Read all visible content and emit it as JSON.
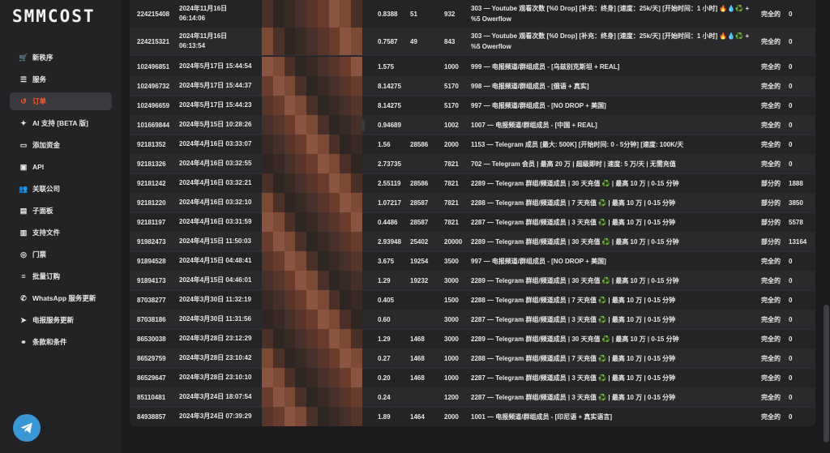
{
  "app": {
    "logo_text": "SMMCOST"
  },
  "sidebar": {
    "items": [
      {
        "label": "新秩序",
        "icon": "cart-icon",
        "glyph": "🛒",
        "active": false
      },
      {
        "label": "服务",
        "icon": "list-icon",
        "glyph": "☰",
        "active": false
      },
      {
        "label": "订单",
        "icon": "history-icon",
        "glyph": "↺",
        "active": true
      },
      {
        "label": "AI 支持 [BETA 版]",
        "icon": "brain-icon",
        "glyph": "✦",
        "active": false
      },
      {
        "label": "添加资金",
        "icon": "wallet-icon",
        "glyph": "▭",
        "active": false
      },
      {
        "label": "API",
        "icon": "api-icon",
        "glyph": "▣",
        "active": false
      },
      {
        "label": "关联公司",
        "icon": "users-icon",
        "glyph": "👥",
        "active": false
      },
      {
        "label": "子面板",
        "icon": "panel-icon",
        "glyph": "▤",
        "active": false
      },
      {
        "label": "支持文件",
        "icon": "library-icon",
        "glyph": "▥",
        "active": false
      },
      {
        "label": "门票",
        "icon": "ticket-icon",
        "glyph": "◎",
        "active": false
      },
      {
        "label": "批量订购",
        "icon": "layers-icon",
        "glyph": "≡",
        "active": false
      },
      {
        "label": "WhatsApp 服务更新",
        "icon": "whatsapp-icon",
        "glyph": "✆",
        "active": false
      },
      {
        "label": "电报服务更新",
        "icon": "telegram-icon",
        "glyph": "➤",
        "active": false
      },
      {
        "label": "条款和条件",
        "icon": "handshake-icon",
        "glyph": "⚭",
        "active": false
      }
    ]
  },
  "colors": {
    "accent": "#ff5a2e",
    "telegram": "#3a97d5"
  },
  "orders": [
    {
      "id": "224215408",
      "date": "2024年11月16日\n06:14:06",
      "charge": "0.8388",
      "start": "51",
      "qty": "932",
      "service": "303 — Youtube 观看次数 [%0 Drop] [补充：终身] [速度：25k/天] [开始时间：1 小时] 🔥💧♻️ + %5 Owerflow",
      "status": "完全的",
      "remains": "0"
    },
    {
      "id": "224215321",
      "date": "2024年11月16日\n06:13:54",
      "charge": "0.7587",
      "start": "49",
      "qty": "843",
      "service": "303 — Youtube 观看次数 [%0 Drop] [补充：终身] [速度：25k/天] [开始时间：1 小时] 🔥💧♻️ + %5 Owerflow",
      "status": "完全的",
      "remains": "0"
    },
    {
      "id": "102496851",
      "date": "2024年5月17日 15:44:54",
      "charge": "1.575",
      "start": "",
      "qty": "1000",
      "service": "999 — 电报频道/群组成员 - [乌兹别克斯坦 + REAL]",
      "status": "完全的",
      "remains": "0"
    },
    {
      "id": "102496732",
      "date": "2024年5月17日 15:44:37",
      "charge": "8.14275",
      "start": "",
      "qty": "5170",
      "service": "998 — 电报频道/群组成员 - [俄语 + 真实]",
      "status": "完全的",
      "remains": "0"
    },
    {
      "id": "102496659",
      "date": "2024年5月17日 15:44:23",
      "charge": "8.14275",
      "start": "",
      "qty": "5170",
      "service": "997 — 电报频道/群组成员 - [NO DROP + 美国]",
      "status": "完全的",
      "remains": "0"
    },
    {
      "id": "101669844",
      "date": "2024年5月15日 10:28:26",
      "charge": "0.94689",
      "start": "",
      "qty": "1002",
      "service": "1007 — 电报频道/群组成员 - [中国 + REAL]",
      "status": "完全的",
      "remains": "0"
    },
    {
      "id": "92181352",
      "date": "2024年4月16日 03:33:07",
      "charge": "1.56",
      "start": "28586",
      "qty": "2000",
      "service": "1153 — Telegram 成员 [最大: 500K] [开始时间: 0 - 5分钟] [速度: 100K/天",
      "status": "完全的",
      "remains": "0"
    },
    {
      "id": "92181326",
      "date": "2024年4月16日 03:32:55",
      "charge": "2.73735",
      "start": "",
      "qty": "7821",
      "service": "702 — Telegram 会员 | 最高 20 万 | 超级即时 | 速度: 5 万/天 | 无需充值",
      "status": "完全的",
      "remains": "0"
    },
    {
      "id": "92181242",
      "date": "2024年4月16日 03:32:21",
      "charge": "2.55119",
      "start": "28586",
      "qty": "7821",
      "service": "2289 — Telegram 群组/频道成员 | 30 天充值 ♻️ | 最高 10 万 | 0-15 分钟",
      "status": "部分的",
      "remains": "1888"
    },
    {
      "id": "92181220",
      "date": "2024年4月16日 03:32:10",
      "charge": "1.07217",
      "start": "28587",
      "qty": "7821",
      "service": "2288 — Telegram 群组/频道成员 | 7 天充值 ♻️ | 最高 10 万 | 0-15 分钟",
      "status": "部分的",
      "remains": "3850"
    },
    {
      "id": "92181197",
      "date": "2024年4月16日 03:31:59",
      "charge": "0.4486",
      "start": "28587",
      "qty": "7821",
      "service": "2287 — Telegram 群组/频道成员 | 3 天充值 ♻️ | 最高 10 万 | 0-15 分钟",
      "status": "部分的",
      "remains": "5578"
    },
    {
      "id": "91982473",
      "date": "2024年4月15日 11:50:03",
      "charge": "2.93948",
      "start": "25402",
      "qty": "20000",
      "service": "2289 — Telegram 群组/频道成员 | 30 天充值 ♻️ | 最高 10 万 | 0-15 分钟",
      "status": "部分的",
      "remains": "13164"
    },
    {
      "id": "91894528",
      "date": "2024年4月15日 04:48:41",
      "charge": "3.675",
      "start": "19254",
      "qty": "3500",
      "service": "997 — 电报频道/群组成员 - [NO DROP + 美国]",
      "status": "完全的",
      "remains": "0"
    },
    {
      "id": "91894173",
      "date": "2024年4月15日 04:46:01",
      "charge": "1.29",
      "start": "19232",
      "qty": "3000",
      "service": "2289 — Telegram 群组/频道成员 | 30 天充值 ♻️ | 最高 10 万 | 0-15 分钟",
      "status": "完全的",
      "remains": "0"
    },
    {
      "id": "87038277",
      "date": "2024年3月30日 11:32:19",
      "charge": "0.405",
      "start": "",
      "qty": "1500",
      "service": "2288 — Telegram 群组/频道成员 | 7 天充值 ♻️ | 最高 10 万 | 0-15 分钟",
      "status": "完全的",
      "remains": "0"
    },
    {
      "id": "87038186",
      "date": "2024年3月30日 11:31:56",
      "charge": "0.60",
      "start": "",
      "qty": "3000",
      "service": "2287 — Telegram 群组/频道成员 | 3 天充值 ♻️ | 最高 10 万 | 0-15 分钟",
      "status": "完全的",
      "remains": "0"
    },
    {
      "id": "86530038",
      "date": "2024年3月28日 23:12:29",
      "charge": "1.29",
      "start": "1468",
      "qty": "3000",
      "service": "2289 — Telegram 群组/频道成员 | 30 天充值 ♻️ | 最高 10 万 | 0-15 分钟",
      "status": "完全的",
      "remains": "0"
    },
    {
      "id": "86529759",
      "date": "2024年3月28日 23:10:42",
      "charge": "0.27",
      "start": "1468",
      "qty": "1000",
      "service": "2288 — Telegram 群组/频道成员 | 7 天充值 ♻️ | 最高 10 万 | 0-15 分钟",
      "status": "完全的",
      "remains": "0"
    },
    {
      "id": "86529647",
      "date": "2024年3月28日 23:10:10",
      "charge": "0.20",
      "start": "1468",
      "qty": "1000",
      "service": "2287 — Telegram 群组/频道成员 | 3 天充值 ♻️ | 最高 10 万 | 0-15 分钟",
      "status": "完全的",
      "remains": "0"
    },
    {
      "id": "85110481",
      "date": "2024年3月24日 18:07:54",
      "charge": "0.24",
      "start": "",
      "qty": "1200",
      "service": "2287 — Telegram 群组/频道成员 | 3 天充值 ♻️ | 最高 10 万 | 0-15 分钟",
      "status": "完全的",
      "remains": "0"
    },
    {
      "id": "84938857",
      "date": "2024年3月24日 07:39:29",
      "charge": "1.89",
      "start": "1464",
      "qty": "2000",
      "service": "1001 — 电报频道/群组成员 - [印尼语 + 真实语言]",
      "status": "完全的",
      "remains": "0"
    }
  ]
}
